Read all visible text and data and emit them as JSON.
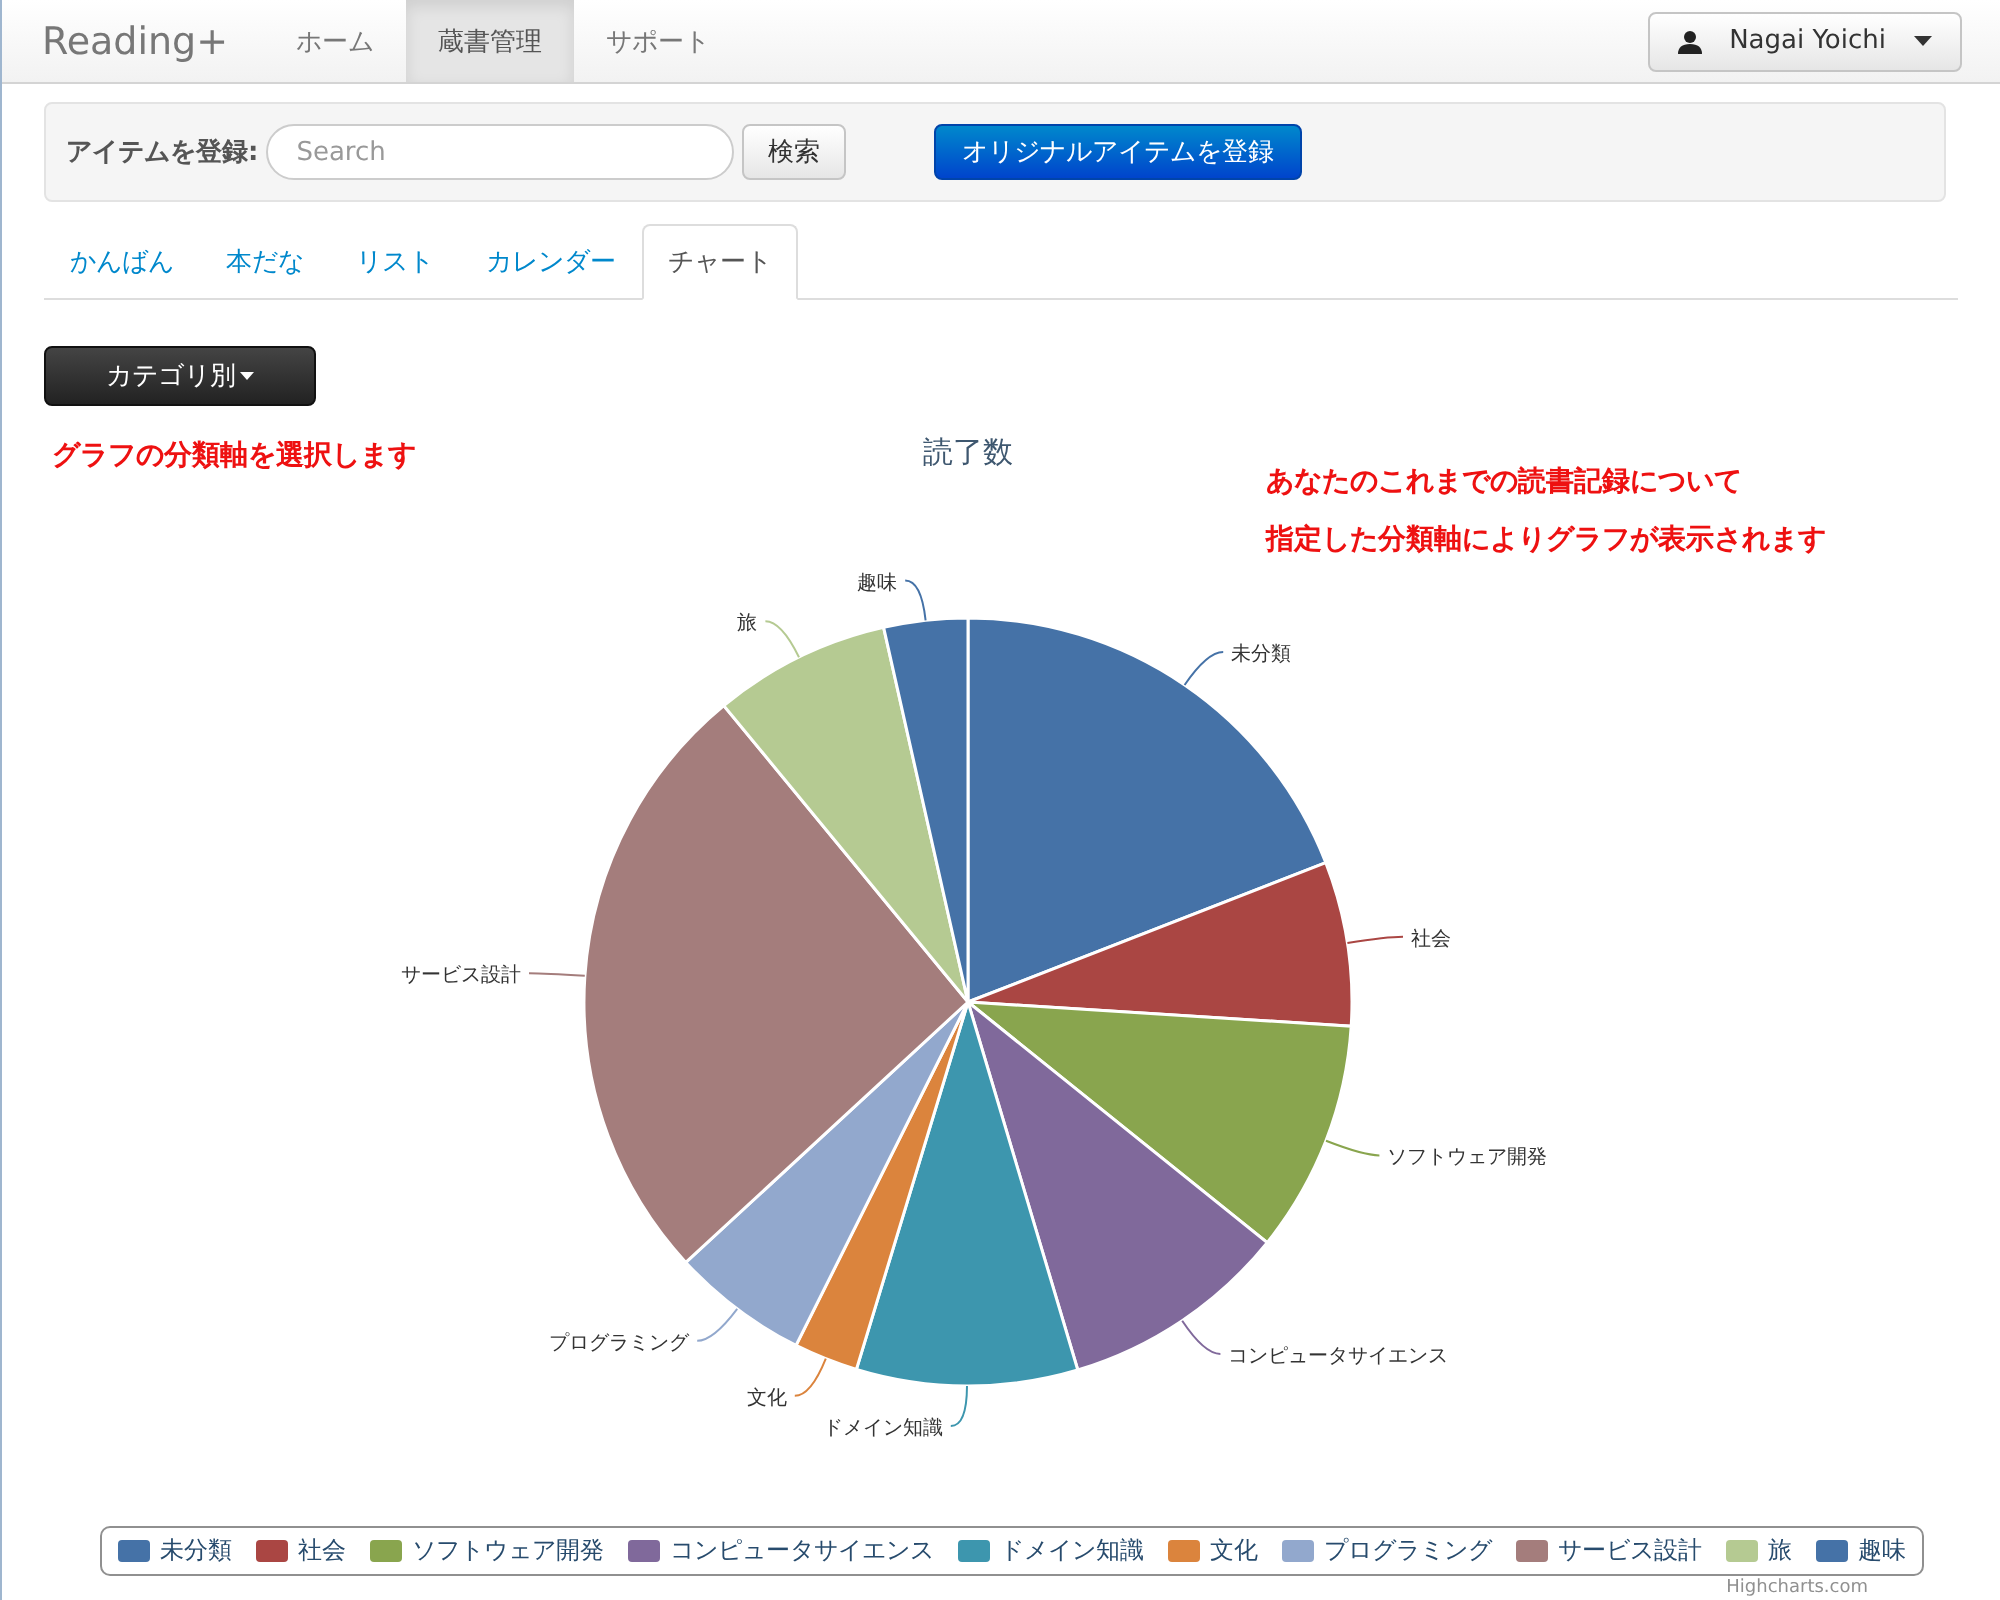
{
  "navbar": {
    "brand": "Reading+",
    "items": [
      {
        "label": "ホーム",
        "selected": false
      },
      {
        "label": "蔵書管理",
        "selected": true
      },
      {
        "label": "サポート",
        "selected": false
      }
    ],
    "user": {
      "name": "Nagai Yoichi"
    }
  },
  "register": {
    "label": "アイテムを登録:",
    "search": {
      "placeholder": "Search"
    },
    "search_button": "検索",
    "original_button": "オリジナルアイテムを登録"
  },
  "tabs": [
    {
      "label": "かんばん",
      "selected": false
    },
    {
      "label": "本だな",
      "selected": false
    },
    {
      "label": "リスト",
      "selected": false
    },
    {
      "label": "カレンダー",
      "selected": false
    },
    {
      "label": "チャート",
      "selected": true
    }
  ],
  "category_button": "カテゴリ別",
  "notes": {
    "left": "グラフの分類軸を選択します",
    "right": [
      "あなたのこれまでの読書記録について",
      "指定した分類軸によりグラフが表示されます"
    ]
  },
  "chart": {
    "title": "読了数",
    "slices": [
      {
        "label": "未分類",
        "color": "#4572a7"
      },
      {
        "label": "社会",
        "color": "#aa4643"
      },
      {
        "label": "ソフトウェア開発",
        "color": "#89a54e"
      },
      {
        "label": "コンピュータサイエンス",
        "color": "#80699b"
      },
      {
        "label": "ドメイン知識",
        "color": "#3d96ae"
      },
      {
        "label": "文化",
        "color": "#db843d"
      },
      {
        "label": "プログラミング",
        "color": "#92a8cd"
      },
      {
        "label": "サービス設計",
        "color": "#a47d7c"
      },
      {
        "label": "旅",
        "color": "#b5ca92"
      },
      {
        "label": "趣味",
        "color": "#4572a7"
      }
    ],
    "legend": [
      {
        "label": "未分類",
        "color": "#4572a7"
      },
      {
        "label": "社会",
        "color": "#aa4643"
      },
      {
        "label": "ソフトウェア開発",
        "color": "#89a54e"
      },
      {
        "label": "コンピュータサイエンス",
        "color": "#80699b"
      },
      {
        "label": "ドメイン知識",
        "color": "#3d96ae"
      },
      {
        "label": "文化",
        "color": "#db843d"
      },
      {
        "label": "プログラミング",
        "color": "#92a8cd"
      },
      {
        "label": "サービス設計",
        "color": "#a47d7c"
      },
      {
        "label": "旅",
        "color": "#b5ca92"
      },
      {
        "label": "趣味",
        "color": "#4572a7"
      }
    ],
    "credit": "Highcharts.com"
  }
}
